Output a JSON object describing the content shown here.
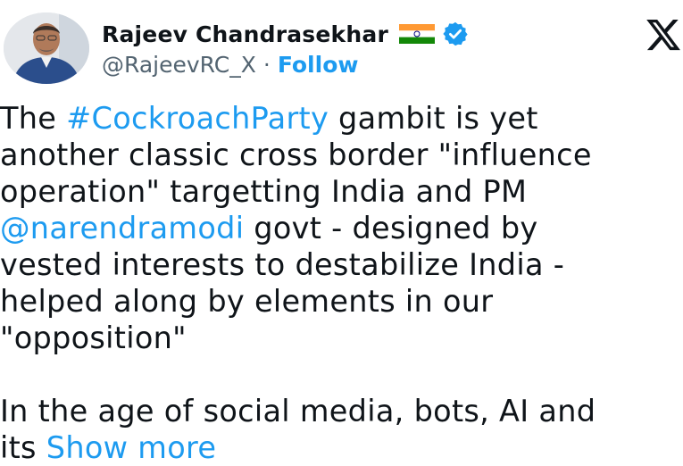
{
  "author": {
    "name": "Rajeev Chandrasekhar",
    "handle": "@RajeevRC_X",
    "separator": "·",
    "follow_label": "Follow",
    "flag_icon": "india-flag-icon",
    "verified_icon": "verified-badge-icon"
  },
  "platform_icon": "x-logo-icon",
  "tweet": {
    "line1_a": "The ",
    "hashtag": "#CockroachParty",
    "line1_b": " gambit is yet",
    "line2": "another classic cross border \"influence",
    "line3": "operation\" targetting India and PM",
    "mention": "@narendramodi",
    "line4_b": " govt - designed by",
    "line5": "vested interests to destabilize India -",
    "line6": "helped along by elements in our",
    "line7": "\"opposition\"",
    "line8": "In the age of social media, bots, AI and",
    "line9_a": "its ",
    "show_more": "Show more"
  },
  "colors": {
    "link": "#1d9bf0",
    "text": "#0f1419",
    "secondary": "#536471",
    "verified": "#1d9bf0"
  }
}
